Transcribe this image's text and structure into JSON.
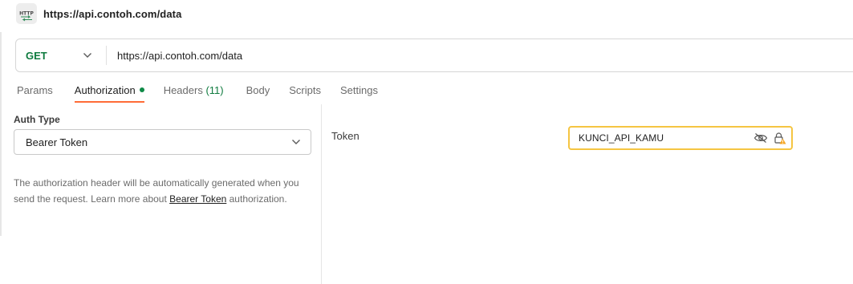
{
  "request": {
    "title": "https://api.contoh.com/data",
    "icon": "http-icon"
  },
  "url_bar": {
    "method": "GET",
    "method_color": "#0f7b3f",
    "url": "https://api.contoh.com/data"
  },
  "tabs": [
    {
      "label": "Params"
    },
    {
      "label": "Authorization",
      "active": true,
      "indicator": "green-dot"
    },
    {
      "label": "Headers",
      "count": "(11)"
    },
    {
      "label": "Body"
    },
    {
      "label": "Scripts"
    },
    {
      "label": "Settings"
    }
  ],
  "auth": {
    "type_label": "Auth Type",
    "type_value": "Bearer Token",
    "description_before": "The authorization header will be automatically generated when you send the request. Learn more about ",
    "description_link": "Bearer Token",
    "description_after": " authorization."
  },
  "token": {
    "label": "Token",
    "value": "KUNCI_API_KAMU",
    "border_color": "#f5c542"
  },
  "colors": {
    "active_tab_underline": "#ff6c37",
    "warning": "#f5a623"
  }
}
